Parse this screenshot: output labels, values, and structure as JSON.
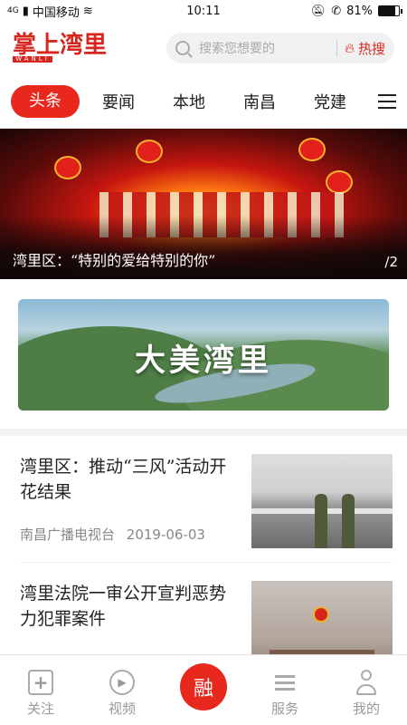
{
  "status_bar": {
    "signal_label": "4G",
    "carrier": "中国移动",
    "time": "10:11",
    "battery": "81%",
    "battery_level": 0.81
  },
  "header": {
    "logo_text": "掌上湾里",
    "logo_sub": "WANLI",
    "search_placeholder": "搜索您想要的",
    "hot_label": "热搜"
  },
  "tabs": [
    {
      "label": "头条",
      "active": true
    },
    {
      "label": "要闻"
    },
    {
      "label": "本地"
    },
    {
      "label": "南昌"
    },
    {
      "label": "党建"
    }
  ],
  "banner": {
    "caption": "湾里区：“特别的爱给特别的你”",
    "counter": "/2"
  },
  "promo": {
    "title": "大美湾里"
  },
  "news": [
    {
      "title": "湾里区：推动“三风”活动开花结果",
      "source": "南昌广播电视台",
      "date": "2019-06-03"
    },
    {
      "title": "湾里法院一审公开宣判恶势力犯罪案件",
      "source": "",
      "date": ""
    }
  ],
  "bottom_nav": [
    {
      "label": "关注",
      "icon": "follow-icon"
    },
    {
      "label": "视频",
      "icon": "video-icon"
    },
    {
      "label": "融",
      "icon": "rong-center-icon"
    },
    {
      "label": "服务",
      "icon": "service-icon"
    },
    {
      "label": "我的",
      "icon": "profile-icon"
    }
  ],
  "colors": {
    "brand_red": "#e8281c",
    "text_gray": "#888888"
  }
}
